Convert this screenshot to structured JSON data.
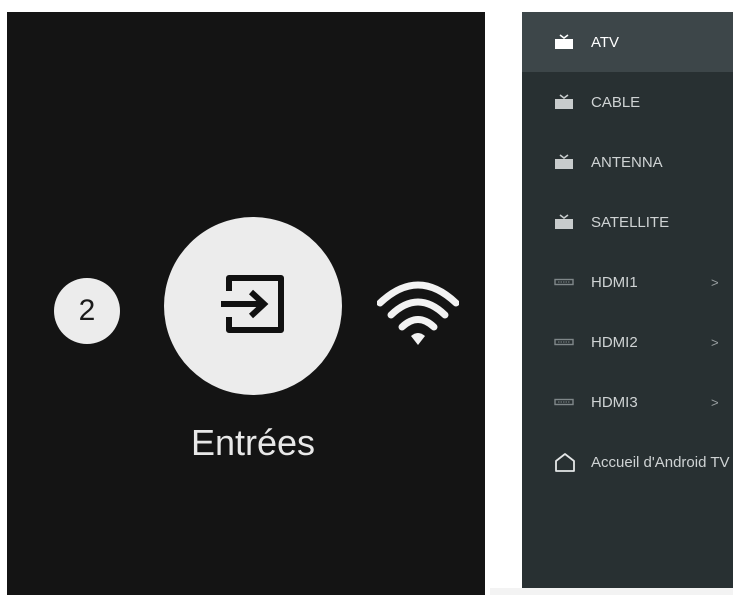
{
  "launcher": {
    "badge_count": "2",
    "focused_label": "Entrées",
    "focused_icon": "input-icon",
    "right_icon": "wifi-icon"
  },
  "inputs_menu": {
    "items": [
      {
        "label": "ATV",
        "icon": "tv-icon",
        "selected": true,
        "arrow": ""
      },
      {
        "label": "CABLE",
        "icon": "tv-icon",
        "selected": false,
        "arrow": ""
      },
      {
        "label": "ANTENNA",
        "icon": "tv-icon",
        "selected": false,
        "arrow": ""
      },
      {
        "label": "SATELLITE",
        "icon": "tv-icon",
        "selected": false,
        "arrow": ""
      },
      {
        "label": "HDMI1",
        "icon": "hdmi-icon",
        "selected": false,
        "arrow": ">"
      },
      {
        "label": "HDMI2",
        "icon": "hdmi-icon",
        "selected": false,
        "arrow": ">"
      },
      {
        "label": "HDMI3",
        "icon": "hdmi-icon",
        "selected": false,
        "arrow": ">"
      },
      {
        "label": "Accueil d'Android TV",
        "icon": "home-icon",
        "selected": false,
        "arrow": ""
      }
    ]
  },
  "colors": {
    "launcher_bg": "#141414",
    "focus_circle": "#ececec",
    "menu_bg": "#283032",
    "menu_selected": "#3d4649"
  }
}
